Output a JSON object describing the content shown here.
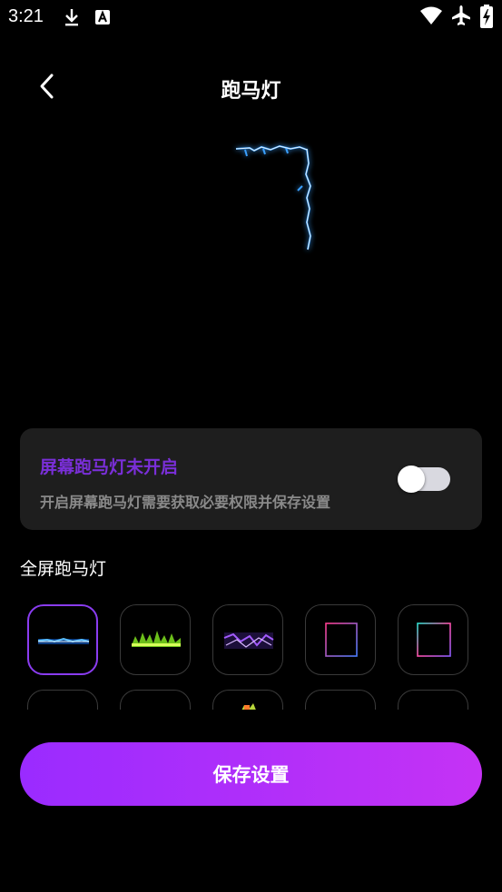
{
  "status_bar": {
    "time": "3:21",
    "icons": [
      "download-icon",
      "a-notification-icon",
      "wifi-icon",
      "airplane-icon",
      "battery-charging-icon"
    ]
  },
  "header": {
    "title": "跑马灯",
    "back_icon": "chevron-left-icon"
  },
  "marquee_status": {
    "title": "屏幕跑马灯未开启",
    "description": "开启屏幕跑马灯需要获取必要权限并保存设置",
    "toggle_on": false,
    "title_color": "#7a2fd8"
  },
  "fullscreen_section": {
    "title": "全屏跑马灯",
    "selected_index": 0,
    "styles": [
      {
        "name": "blue-lightning"
      },
      {
        "name": "green-fire"
      },
      {
        "name": "purple-lightning"
      },
      {
        "name": "pink-blue-frame"
      },
      {
        "name": "rainbow-frame"
      },
      {
        "name": "style-6"
      },
      {
        "name": "style-7"
      },
      {
        "name": "style-8"
      },
      {
        "name": "style-9"
      },
      {
        "name": "style-10"
      }
    ]
  },
  "save_button": {
    "label": "保存设置",
    "gradient": [
      "#9a2bff",
      "#c532f5"
    ]
  }
}
